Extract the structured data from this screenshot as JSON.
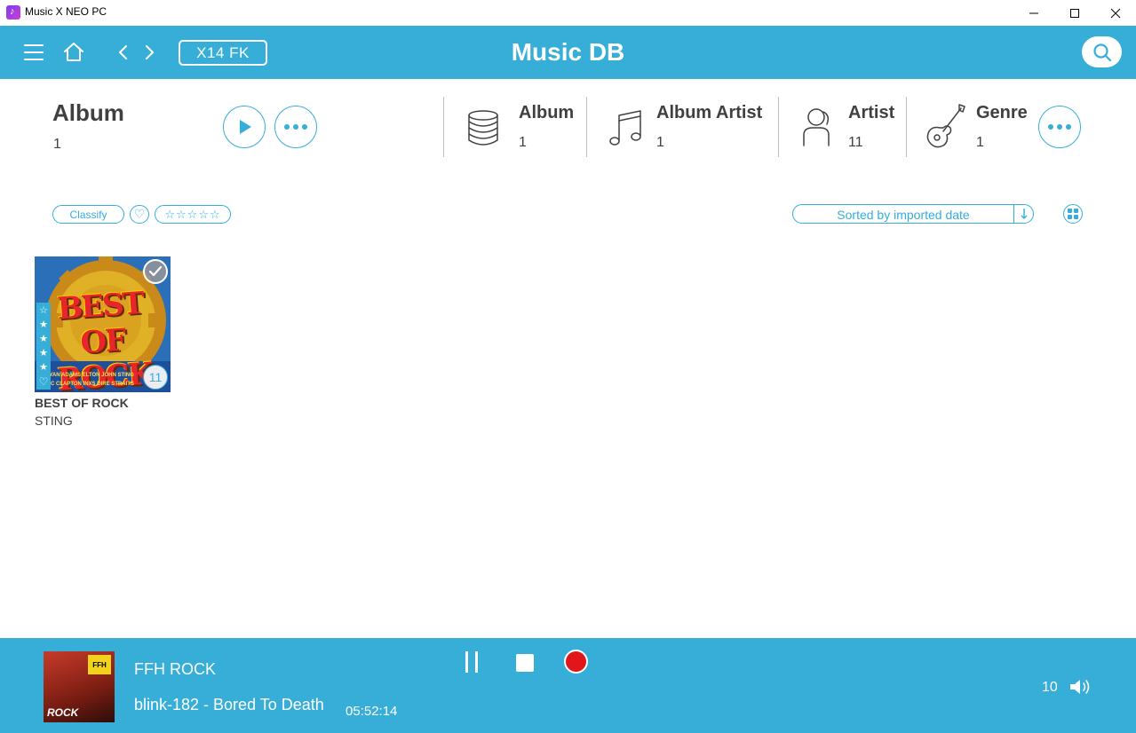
{
  "window": {
    "title": "Music X NEO PC"
  },
  "header": {
    "device": "X14 FK",
    "title": "Music DB"
  },
  "section": {
    "title": "Album",
    "count": "1"
  },
  "categories": [
    {
      "label": "Album",
      "count": "1",
      "icon": "database-icon"
    },
    {
      "label": "Album Artist",
      "count": "1",
      "icon": "music-note-icon"
    },
    {
      "label": "Artist",
      "count": "11",
      "icon": "person-icon"
    },
    {
      "label": "Genre",
      "count": "1",
      "icon": "guitar-icon"
    }
  ],
  "filters": {
    "classify": "Classify",
    "heart": "♡",
    "stars": "☆☆☆☆☆",
    "sort": "Sorted by imported date"
  },
  "albums": [
    {
      "title": "BEST OF ROCK",
      "artist": "STING",
      "track_count": "11",
      "cover_title": "BEST OF ROCK",
      "cover_names": [
        "BRYAN ADAMS   ELTON JOHN   STING",
        "ERIC CLAPTON   INXS   DIRE STRAITS"
      ]
    }
  ],
  "player": {
    "station": "FFH ROCK",
    "track": "blink-182 - Bored To Death",
    "time": "05:52:14",
    "volume": "10",
    "cover_badge": "FFH",
    "cover_label": "ROCK"
  },
  "colors": {
    "accent": "#36aed8",
    "record": "#e0161a",
    "text": "#404040"
  }
}
